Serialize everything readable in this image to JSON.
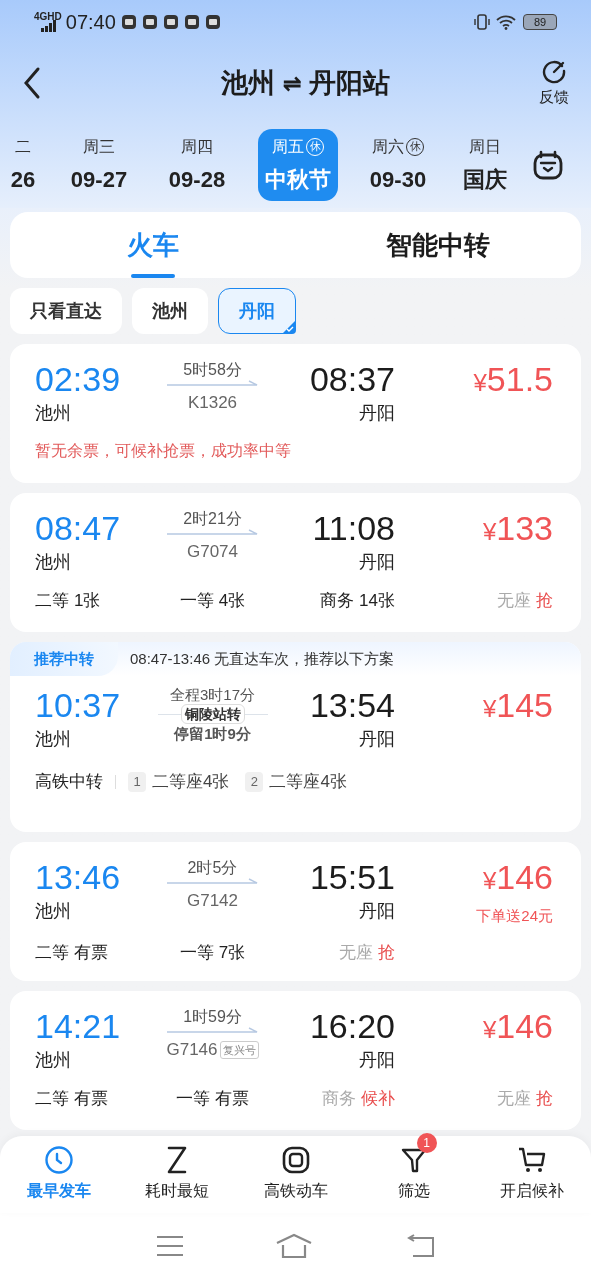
{
  "status_bar": {
    "network": "4GHD",
    "time": "07:40",
    "battery": "89"
  },
  "header": {
    "from": "池州",
    "swap": "⇌",
    "to": "丹阳站",
    "feedback": "反馈"
  },
  "dates": [
    {
      "weekday": "二",
      "date": "26",
      "selected": false
    },
    {
      "weekday": "周三",
      "date": "09-27",
      "selected": false
    },
    {
      "weekday": "周四",
      "date": "09-28",
      "selected": false
    },
    {
      "weekday": "周五",
      "holiday_mark": "休",
      "date": "中秋节",
      "selected": true
    },
    {
      "weekday": "周六",
      "holiday_mark": "休",
      "date": "09-30",
      "selected": false
    },
    {
      "weekday": "周日",
      "date": "国庆",
      "selected": false
    }
  ],
  "mode_tabs": [
    {
      "label": "火车",
      "selected": true
    },
    {
      "label": "智能中转",
      "selected": false
    }
  ],
  "filters": [
    {
      "label": "只看直达",
      "selected": false
    },
    {
      "label": "池州",
      "selected": false
    },
    {
      "label": "丹阳",
      "selected": true
    }
  ],
  "trains": [
    {
      "kind": "direct",
      "depart": "02:39",
      "from": "池州",
      "duration": "5时58分",
      "train_no": "K1326",
      "arrive": "08:37",
      "to": "丹阳",
      "currency": "¥",
      "price": "51.5",
      "notice": "暂无余票，可候补抢票，成功率中等"
    },
    {
      "kind": "direct",
      "depart": "08:47",
      "from": "池州",
      "duration": "2时21分",
      "train_no": "G7074",
      "arrive": "11:08",
      "to": "丹阳",
      "currency": "¥",
      "price": "133",
      "seats": [
        {
          "label": "二等",
          "status": "1张",
          "sold_out": false
        },
        {
          "label": "一等",
          "status": "4张",
          "sold_out": false
        },
        {
          "label": "商务",
          "status": "14张",
          "sold_out": false
        },
        {
          "label": "无座",
          "status": "抢",
          "sold_out": true
        }
      ]
    },
    {
      "kind": "transfer",
      "tag": "推荐中转",
      "summary": "08:47-13:46 无直达车次，推荐以下方案",
      "depart": "10:37",
      "from": "池州",
      "total": "全程3时17分",
      "station": "铜陵站转",
      "stop": "停留1时9分",
      "arrive": "13:54",
      "to": "丹阳",
      "currency": "¥",
      "price": "145",
      "route_type": "高铁中转",
      "legs": [
        {
          "index": "1",
          "seats": "二等座4张"
        },
        {
          "index": "2",
          "seats": "二等座4张"
        }
      ]
    },
    {
      "kind": "direct",
      "depart": "13:46",
      "from": "池州",
      "duration": "2时5分",
      "train_no": "G7142",
      "arrive": "15:51",
      "to": "丹阳",
      "currency": "¥",
      "price": "146",
      "promo": "下单送24元",
      "seats": [
        {
          "label": "二等",
          "status": "有票",
          "sold_out": false
        },
        {
          "label": "一等",
          "status": "7张",
          "sold_out": false
        },
        {
          "label": "无座",
          "status": "抢",
          "sold_out": true
        }
      ]
    },
    {
      "kind": "direct",
      "depart": "14:21",
      "from": "池州",
      "duration": "1时59分",
      "train_no": "G7146",
      "badge": "复兴号",
      "arrive": "16:20",
      "to": "丹阳",
      "currency": "¥",
      "price": "146",
      "seats": [
        {
          "label": "二等",
          "status": "有票",
          "sold_out": false
        },
        {
          "label": "一等",
          "status": "有票",
          "sold_out": false
        },
        {
          "label": "商务",
          "status": "候补",
          "sold_out": true
        },
        {
          "label": "无座",
          "status": "抢",
          "sold_out": true
        }
      ]
    }
  ],
  "bottom_nav": [
    {
      "label": "最早发车",
      "selected": true
    },
    {
      "label": "耗时最短",
      "selected": false
    },
    {
      "label": "高铁动车",
      "selected": false
    },
    {
      "label": "筛选",
      "selected": false,
      "badge": "1"
    },
    {
      "label": "开启候补",
      "selected": false
    }
  ]
}
